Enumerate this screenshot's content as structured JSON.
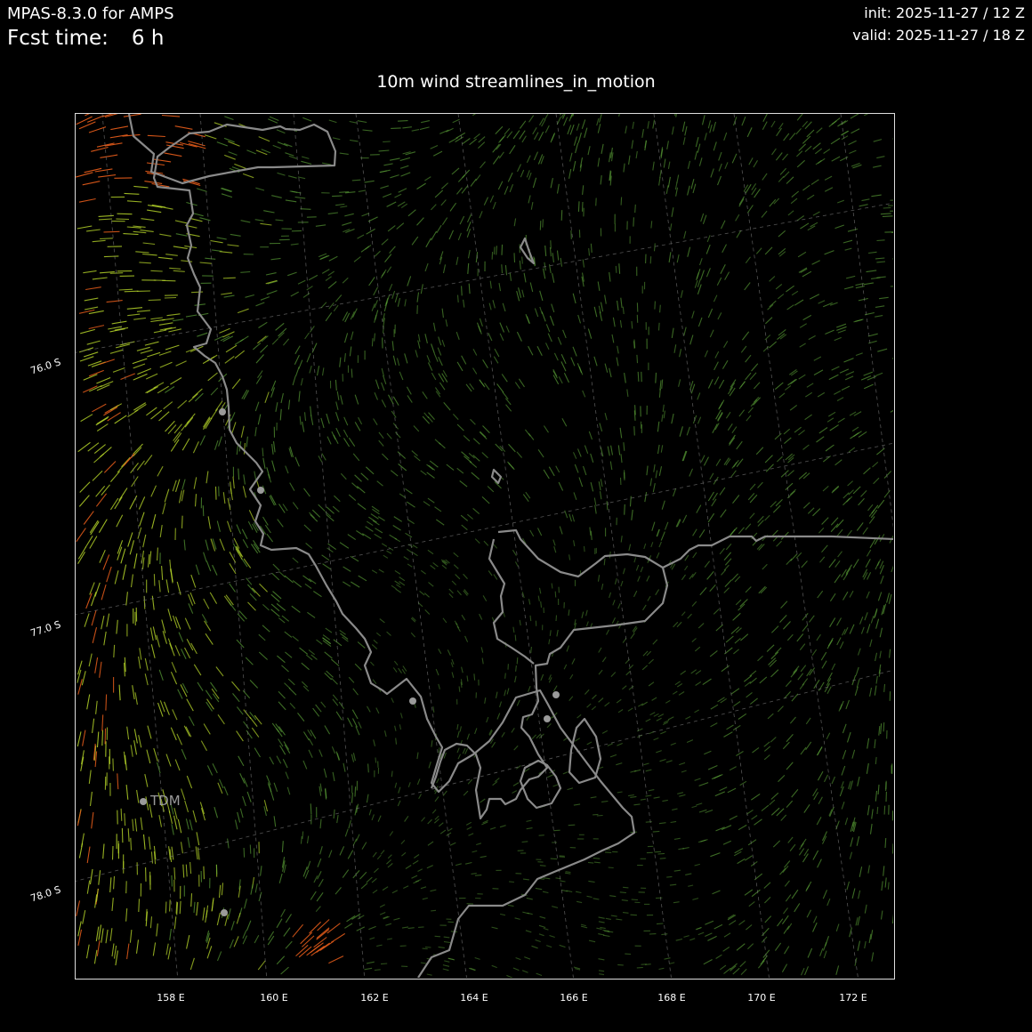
{
  "header": {
    "model": "MPAS-8.3.0 for AMPS",
    "fcst_label": "Fcst time:",
    "fcst_value": "6 h",
    "init": "init: 2025-11-27 / 12 Z",
    "valid": "valid: 2025-11-27 / 18 Z"
  },
  "map": {
    "title": "10m wind streamlines_in_motion",
    "x_ticks": [
      "158 E",
      "160 E",
      "162 E",
      "164 E",
      "166 E",
      "168 E",
      "170 E",
      "172 E"
    ],
    "y_ticks": [
      "76.0 S",
      "77.0 S",
      "78.0 S"
    ],
    "station_label": "TDM",
    "colors": {
      "background": "#000000",
      "coastline": "#8a8a8a",
      "gridline": "#777777",
      "wind_weak": "#5fa83a",
      "wind_moderate": "#b8d82a",
      "wind_strong": "#e05a1a",
      "station": "#9a9a9a"
    }
  }
}
